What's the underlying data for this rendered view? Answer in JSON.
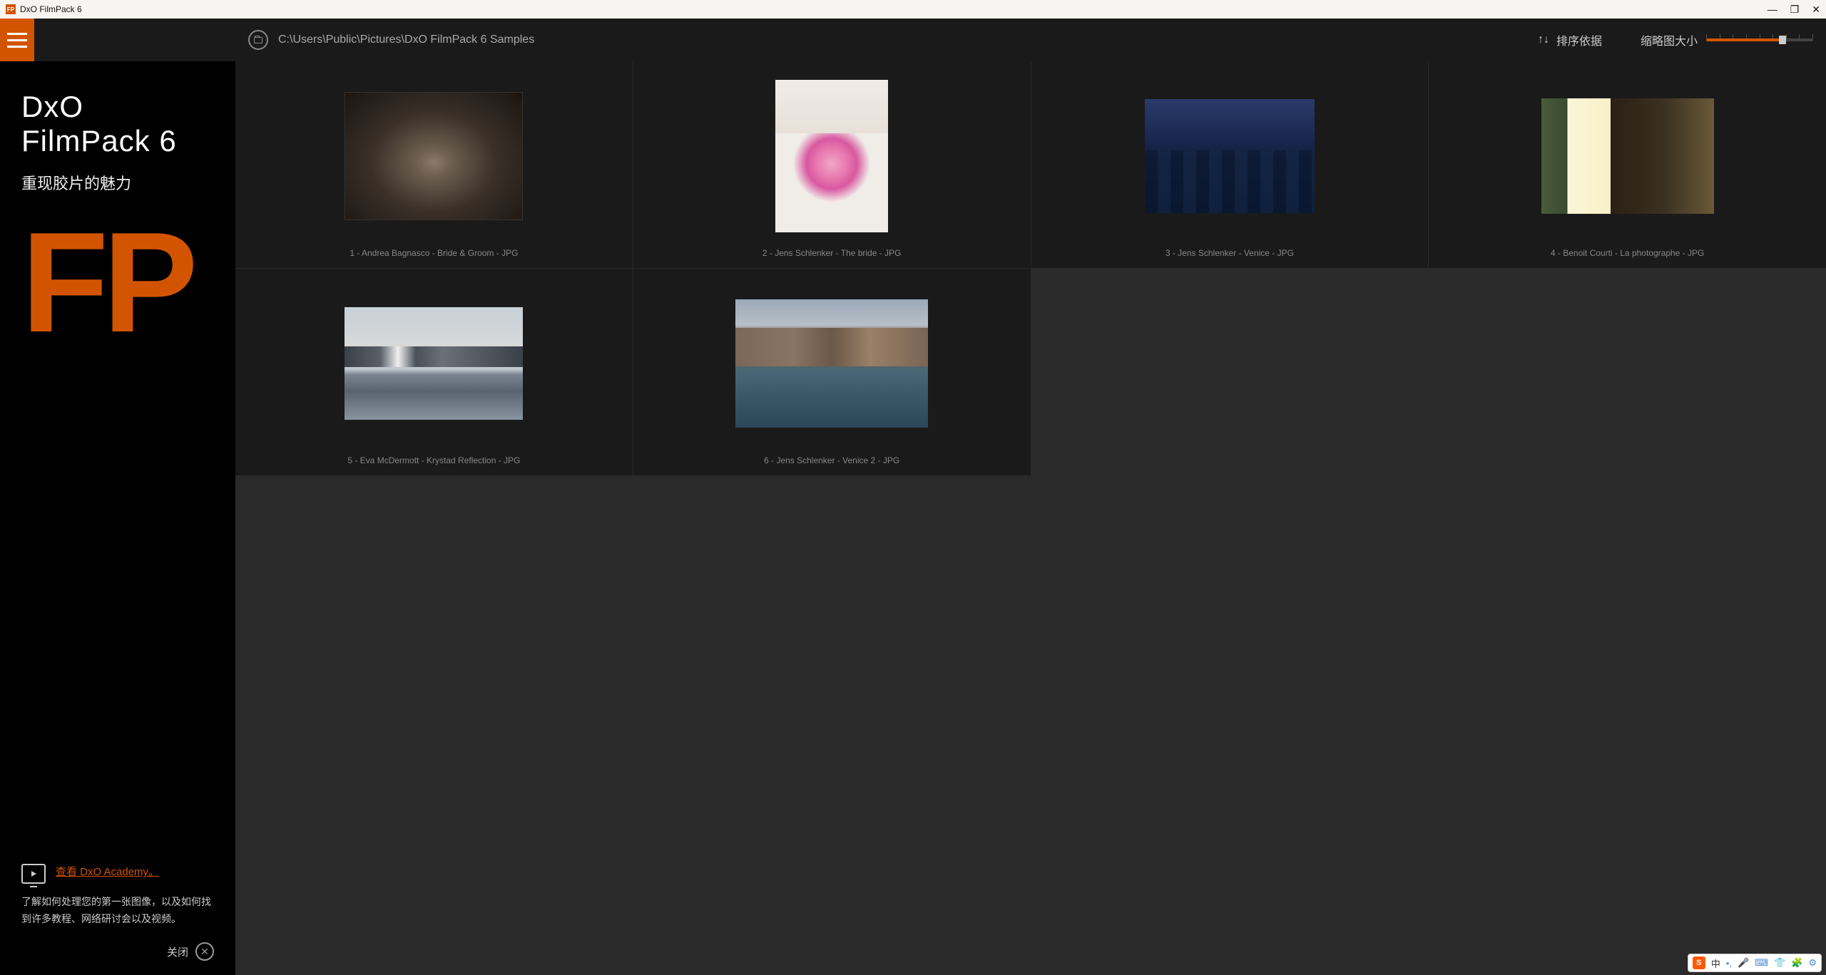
{
  "window": {
    "title": "DxO FilmPack 6",
    "minimize": "—",
    "maximize": "❐",
    "close": "✕"
  },
  "toolbar": {
    "path": "C:\\Users\\Public\\Pictures\\DxO FilmPack 6 Samples",
    "sort_label": "排序依据",
    "size_label": "缩略图大小"
  },
  "sidebar": {
    "brand_line1": "DxO",
    "brand_line2": "FilmPack 6",
    "tagline": "重现胶片的魅力",
    "fp_mark": "FP",
    "academy_link": "查看 DxO Academy。",
    "academy_desc": "了解如何处理您的第一张图像，以及如何找到许多教程、网络研讨会以及视频。",
    "close_label": "关闭"
  },
  "thumbnails": [
    {
      "caption": "1 - Andrea Bagnasco - Bride & Groom - JPG"
    },
    {
      "caption": "2 - Jens Schlenker - The bride - JPG"
    },
    {
      "caption": "3 - Jens Schlenker - Venice - JPG"
    },
    {
      "caption": "4 - Benoit Courti - La photographe - JPG"
    },
    {
      "caption": "5 - Eva McDermott - Krystad Reflection - JPG"
    },
    {
      "caption": "6 - Jens Schlenker - Venice 2 - JPG"
    }
  ],
  "ime": {
    "logo": "S",
    "lang": "中"
  }
}
